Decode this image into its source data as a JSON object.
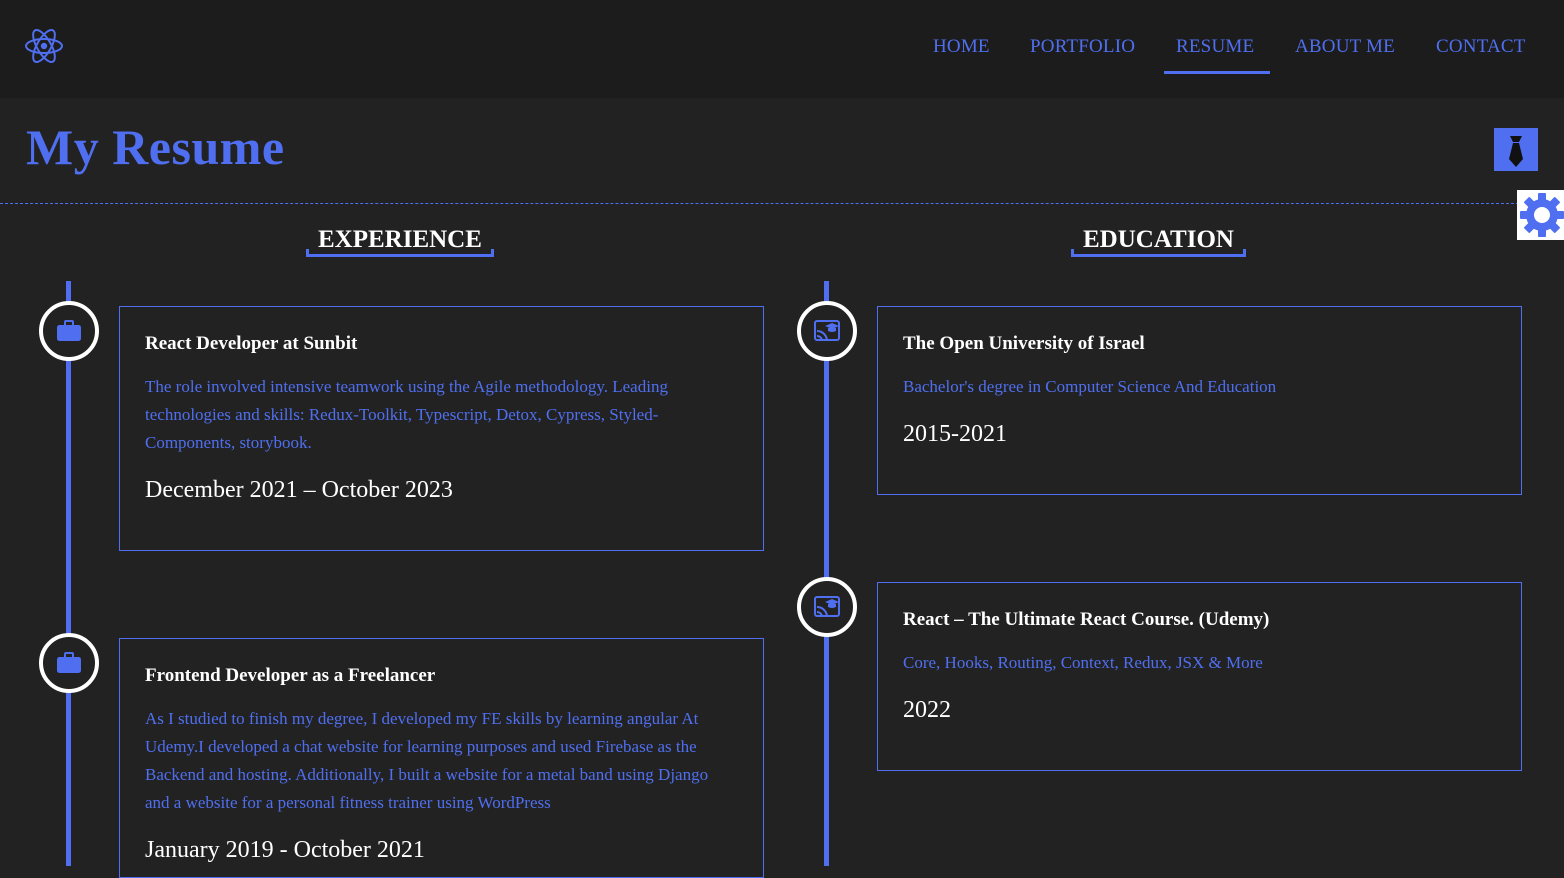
{
  "nav": {
    "logo_icon": "react-atom-icon",
    "links": [
      {
        "label": "HOME"
      },
      {
        "label": "PORTFOLIO"
      },
      {
        "label": "RESUME",
        "active": true
      },
      {
        "label": "ABOUT ME"
      },
      {
        "label": "CONTACT"
      }
    ]
  },
  "header": {
    "title": "My Resume",
    "resume_button_icon": "tie-icon",
    "settings_button_icon": "gear-icon"
  },
  "experience": {
    "heading": "EXPERIENCE",
    "icon": "briefcase-icon",
    "items": [
      {
        "title": "React Developer at Sunbit",
        "description": "The role involved intensive teamwork using the Agile methodology. Leading technologies and skills: Redux-Toolkit, Typescript, Detox, Cypress, Styled-Components, storybook.",
        "date": "December 2021 – October 2023"
      },
      {
        "title": "Frontend Developer as a Freelancer",
        "description": "As I studied to finish my degree, I developed my FE skills by learning angular At Udemy.I developed a chat website for learning purposes and used Firebase as the Backend and hosting. Additionally, I built a website for a metal band using Django and a website for a personal fitness trainer using WordPress",
        "date": "January 2019 - October 2021"
      }
    ]
  },
  "education": {
    "heading": "EDUCATION",
    "icon": "graduation-screen-icon",
    "items": [
      {
        "title": "The Open University of Israel",
        "description": "Bachelor's degree in Computer Science And Education",
        "date": "2015-2021"
      },
      {
        "title": "React – The Ultimate React Course. (Udemy)",
        "description": "Core, Hooks, Routing, Context, Redux, JSX & More",
        "date": "2022"
      }
    ]
  },
  "colors": {
    "accent": "#4f6ff0",
    "background": "#222222",
    "navbar": "#1c1c1c",
    "text": "#ffffff"
  }
}
